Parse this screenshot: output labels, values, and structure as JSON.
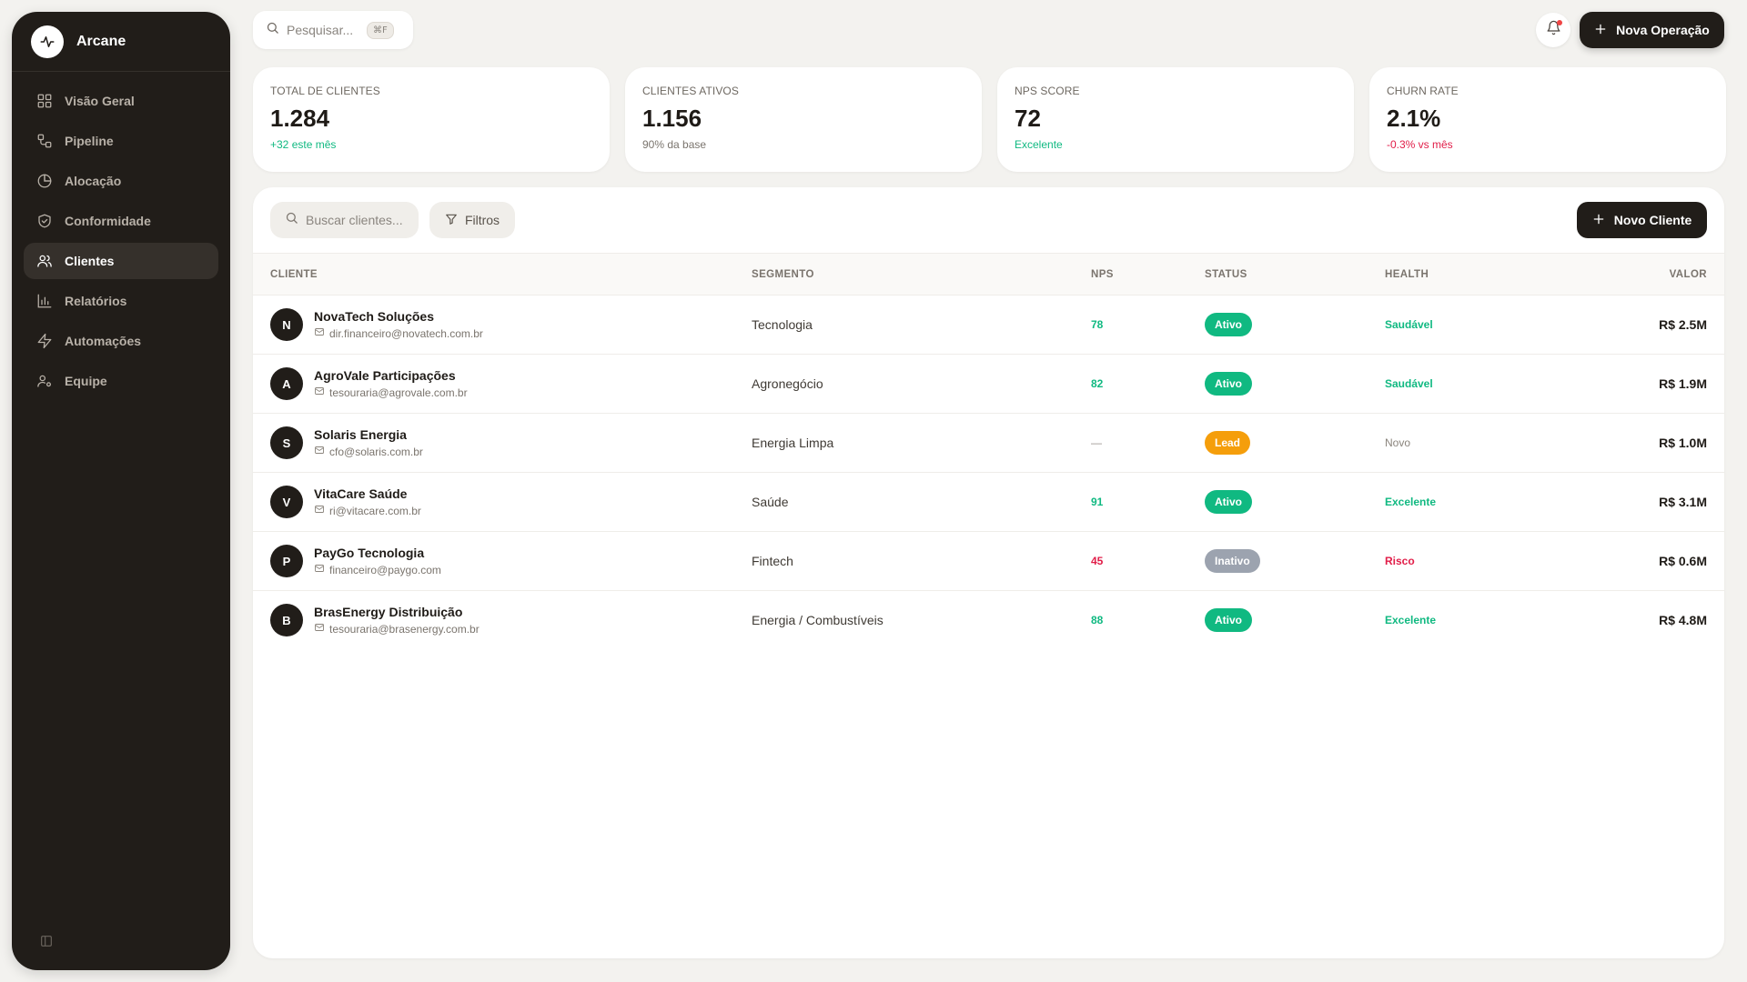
{
  "app": {
    "name": "Arcane"
  },
  "sidebar": {
    "items": [
      {
        "label": "Visão Geral",
        "icon": "grid-icon",
        "active": false
      },
      {
        "label": "Pipeline",
        "icon": "workflow-icon",
        "active": false
      },
      {
        "label": "Alocação",
        "icon": "pie-chart-icon",
        "active": false
      },
      {
        "label": "Conformidade",
        "icon": "shield-check-icon",
        "active": false
      },
      {
        "label": "Clientes",
        "icon": "users-icon",
        "active": true
      },
      {
        "label": "Relatórios",
        "icon": "bar-chart-icon",
        "active": false
      },
      {
        "label": "Automações",
        "icon": "zap-icon",
        "active": false
      },
      {
        "label": "Equipe",
        "icon": "user-cog-icon",
        "active": false
      }
    ]
  },
  "topbar": {
    "search_placeholder": "Pesquisar...",
    "shortcut": "⌘F",
    "new_operation_label": "Nova Operação"
  },
  "kpis": [
    {
      "label": "TOTAL DE CLIENTES",
      "value": "1.284",
      "sub": "+32 este mês",
      "tone": "green"
    },
    {
      "label": "CLIENTES ATIVOS",
      "value": "1.156",
      "sub": "90% da base",
      "tone": "muted"
    },
    {
      "label": "NPS SCORE",
      "value": "72",
      "sub": "Excelente",
      "tone": "green"
    },
    {
      "label": "CHURN RATE",
      "value": "2.1%",
      "sub": "-0.3% vs mês",
      "tone": "red"
    }
  ],
  "clients_panel": {
    "search_placeholder": "Buscar clientes...",
    "filter_label": "Filtros",
    "new_client_label": "Novo Cliente",
    "columns": [
      "CLIENTE",
      "SEGMENTO",
      "NPS",
      "STATUS",
      "HEALTH",
      "VALOR"
    ],
    "rows": [
      {
        "initial": "N",
        "name": "NovaTech Soluções",
        "email": "dir.financeiro@novatech.com.br",
        "segment": "Tecnologia",
        "nps": "78",
        "nps_tone": "green",
        "status": "Ativo",
        "status_kind": "ativo",
        "health": "Saudável",
        "health_tone": "green",
        "value": "R$ 2.5M"
      },
      {
        "initial": "A",
        "name": "AgroVale Participações",
        "email": "tesouraria@agrovale.com.br",
        "segment": "Agronegócio",
        "nps": "82",
        "nps_tone": "green",
        "status": "Ativo",
        "status_kind": "ativo",
        "health": "Saudável",
        "health_tone": "green",
        "value": "R$ 1.9M"
      },
      {
        "initial": "S",
        "name": "Solaris Energia",
        "email": "cfo@solaris.com.br",
        "segment": "Energia Limpa",
        "nps": "—",
        "nps_tone": "dash",
        "status": "Lead",
        "status_kind": "lead",
        "health": "Novo",
        "health_tone": "novo",
        "value": "R$ 1.0M"
      },
      {
        "initial": "V",
        "name": "VitaCare Saúde",
        "email": "ri@vitacare.com.br",
        "segment": "Saúde",
        "nps": "91",
        "nps_tone": "green",
        "status": "Ativo",
        "status_kind": "ativo",
        "health": "Excelente",
        "health_tone": "green",
        "value": "R$ 3.1M"
      },
      {
        "initial": "P",
        "name": "PayGo Tecnologia",
        "email": "financeiro@paygo.com",
        "segment": "Fintech",
        "nps": "45",
        "nps_tone": "red",
        "status": "Inativo",
        "status_kind": "inativo",
        "health": "Risco",
        "health_tone": "red",
        "value": "R$ 0.6M"
      },
      {
        "initial": "B",
        "name": "BrasEnergy Distribuição",
        "email": "tesouraria@brasenergy.com.br",
        "segment": "Energia / Combustíveis",
        "nps": "88",
        "nps_tone": "green",
        "status": "Ativo",
        "status_kind": "ativo",
        "health": "Excelente",
        "health_tone": "green",
        "value": "R$ 4.8M"
      }
    ]
  },
  "colors": {
    "sidebar_bg": "#211d19",
    "accent_dark": "#211d19",
    "success": "#10b981",
    "warning": "#f59e0b",
    "danger": "#e11d48",
    "neutral_badge": "#9ca3af"
  }
}
